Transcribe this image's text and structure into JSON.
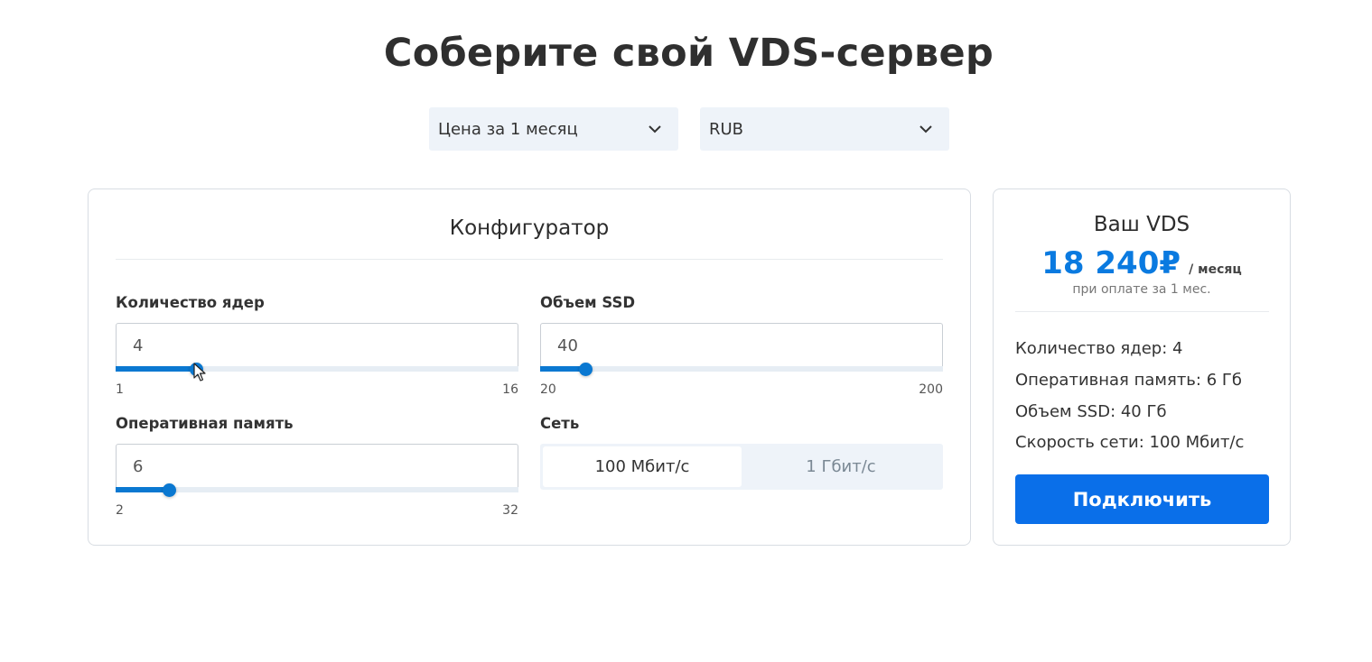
{
  "page": {
    "title": "Соберите свой VDS-сервер"
  },
  "filters": {
    "period": {
      "selected": "Цена за 1 месяц",
      "icon": "chevron-down-icon"
    },
    "currency": {
      "selected": "RUB",
      "icon": "chevron-down-icon"
    }
  },
  "configurator": {
    "heading": "Конфигуратор",
    "cores": {
      "label": "Количество ядер",
      "value": "4",
      "min": "1",
      "max": "16",
      "level": 0.2
    },
    "ssd": {
      "label": "Объем SSD",
      "value": "40",
      "min": "20",
      "max": "200",
      "level": 0.111
    },
    "ram": {
      "label": "Оперативная память",
      "value": "6",
      "min": "2",
      "max": "32",
      "level": 0.133
    },
    "network": {
      "label": "Сеть",
      "options": [
        {
          "label": "100 Мбит/с",
          "active": true
        },
        {
          "label": "1 Гбит/с",
          "active": false
        }
      ]
    }
  },
  "summary": {
    "title": "Ваш VDS",
    "price": "18 240",
    "currency_symbol": "₽",
    "per_period": "/ месяц",
    "note": "при оплате за 1 мес.",
    "specs": [
      "Количество ядер: 4",
      "Оперативная память: 6 Гб",
      "Объем SSD: 40 Гб",
      "Скорость сети: 100 Мбит/с"
    ],
    "button": "Подключить"
  },
  "colors": {
    "accent": "#0a78d1",
    "price": "#0a7ae0",
    "button": "#0a6fe9",
    "select_bg": "#eef3f9"
  }
}
